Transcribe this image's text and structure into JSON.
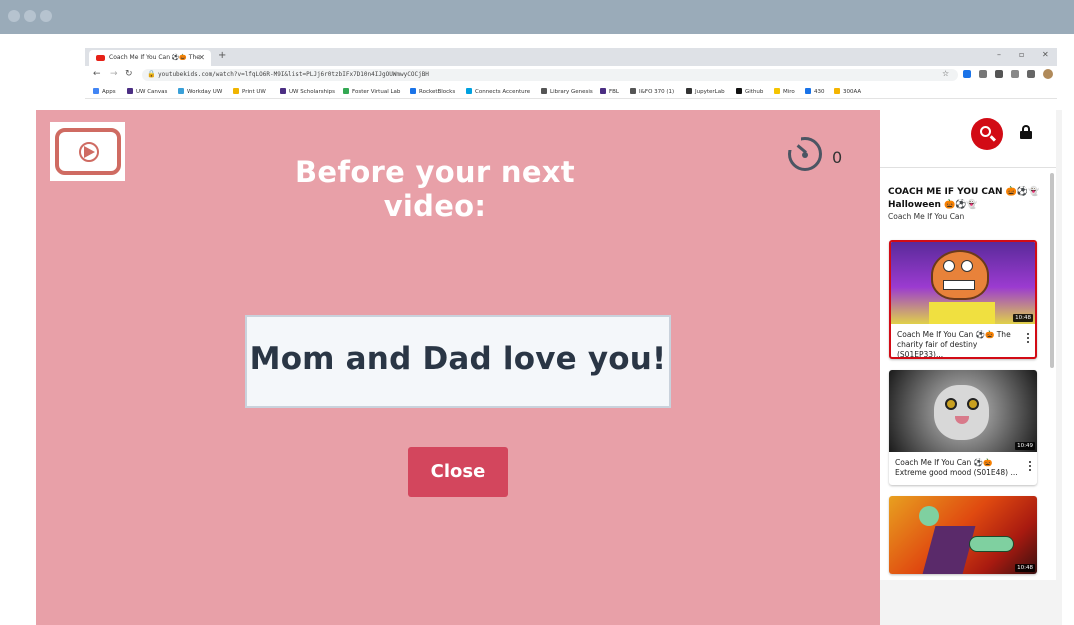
{
  "browser": {
    "tab_title": "Coach Me If You Can ⚽🎃 The",
    "url": "youtubekids.com/watch?v=lfqLO6R-M9I&list=PLJj6r0tzbIFx7D10n4IJgOUWmwyCOCjBH",
    "bookmarks": [
      "Apps",
      "UW Canvas",
      "Workday UW",
      "Print UW",
      "UW Scholarships",
      "Foster Virtual Lab",
      "RocketBlocks",
      "Connects Accenture",
      "Library Genesis",
      "FBL",
      "I&FO 370 (1)",
      "JupyterLab",
      "Github",
      "Miro",
      "430",
      "300AA"
    ],
    "bookmark_colors": [
      "#4285f4",
      "#4b2e83",
      "#3aa0d8",
      "#f0b400",
      "#4b2e83",
      "#34a853",
      "#1a73e8",
      "#00a1e0",
      "#555555",
      "#4b2e83",
      "#555555",
      "#333333",
      "#111111",
      "#f5c400",
      "#1a73e8",
      "#f4b400"
    ]
  },
  "overlay": {
    "headline": "Before your next video:",
    "timer_count": "0",
    "message": "Mom and Dad love you!",
    "close_label": "Close",
    "background_color": "#e8a0a8",
    "button_color": "#d3465d"
  },
  "sidebar": {
    "channel_title": "COACH ME IF YOU CAN 🎃⚽👻 Halloween 🎃⚽👻",
    "channel_subtitle": "Coach Me If You Can",
    "videos": [
      {
        "title": "Coach Me If You Can ⚽🎃 The charity fair of destiny (S01EP33)...",
        "duration": "10:48",
        "active": true
      },
      {
        "title": "Coach Me If You Can ⚽🎃 Extreme good mood (S01E48) ...",
        "duration": "10:49",
        "active": false
      },
      {
        "title": "",
        "duration": "10:48",
        "active": false
      }
    ]
  }
}
